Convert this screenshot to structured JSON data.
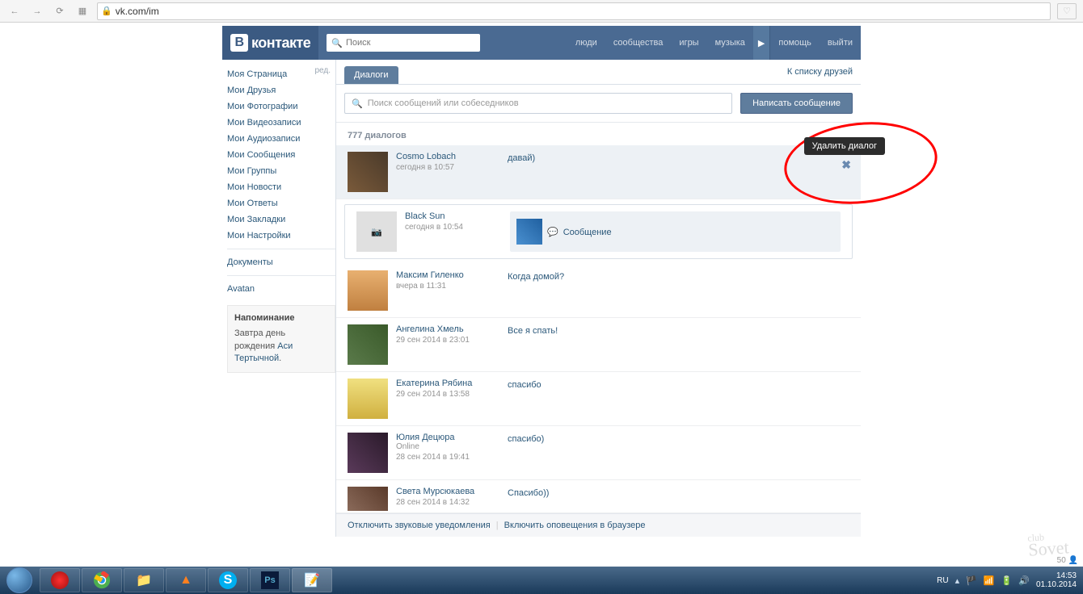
{
  "browser": {
    "url": "vk.com/im"
  },
  "header": {
    "logo": "контакте",
    "search_placeholder": "Поиск",
    "nav": [
      "люди",
      "сообщества",
      "игры",
      "музыка"
    ],
    "nav_right": [
      "помощь",
      "выйти"
    ]
  },
  "sidebar": {
    "my_page": "Моя Страница",
    "edit": "ред.",
    "items": [
      "Мои Друзья",
      "Мои Фотографии",
      "Мои Видеозаписи",
      "Мои Аудиозаписи",
      "Мои Сообщения",
      "Мои Группы",
      "Мои Новости",
      "Мои Ответы",
      "Мои Закладки",
      "Мои Настройки"
    ],
    "docs": "Документы",
    "avatan": "Avatan",
    "reminder_title": "Напоминание",
    "reminder_text1": "Завтра ",
    "reminder_text2": "день рождения ",
    "reminder_link": "Аси Тертычной",
    "reminder_dot": "."
  },
  "content": {
    "tab": "Диалоги",
    "friends_link": "К списку друзей",
    "search_placeholder": "Поиск сообщений или собеседников",
    "write_btn": "Написать сообщение",
    "count": "777 диалогов",
    "tooltip": "Удалить диалог",
    "dialogs": [
      {
        "name": "Cosmo Lobach",
        "time": "сегодня в 10:57",
        "msg": "давай)"
      },
      {
        "name": "Black Sun",
        "time": "сегодня в 10:54",
        "msg": "Сообщение"
      },
      {
        "name": "Максим Гиленко",
        "time": "вчера в 11:31",
        "msg": "Когда домой?"
      },
      {
        "name": "Ангелина Хмель",
        "time": "29 сен 2014 в 23:01",
        "msg": "Все я спать!"
      },
      {
        "name": "Екатерина Рябина",
        "time": "29 сен 2014 в 13:58",
        "msg": "спасибо"
      },
      {
        "name": "Юлия Децюра",
        "time": "28 сен 2014 в 19:41",
        "msg": "спасибо)",
        "online": "Online"
      },
      {
        "name": "Света Мурсюкаева",
        "time": "28 сен 2014 в 14:32",
        "msg": "Спасибо))"
      }
    ],
    "footer_sound": "Отключить звуковые уведомления",
    "footer_browser": "Включить оповещения в браузере"
  },
  "watermark": {
    "top": "club",
    "bottom": "Sovet",
    "count": "50"
  },
  "taskbar": {
    "lang": "RU",
    "time": "14:53",
    "date": "01.10.2014"
  }
}
